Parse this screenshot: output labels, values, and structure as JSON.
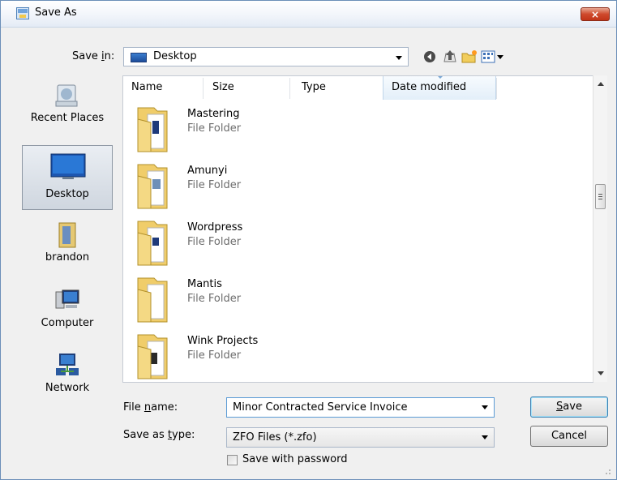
{
  "window": {
    "title": "Save As",
    "close_label": "×"
  },
  "toolbar": {
    "save_in_label_prefix": "Save ",
    "save_in_label_hotkey": "i",
    "save_in_label_suffix": "n:",
    "save_in_value": "Desktop",
    "icons": [
      "back-icon",
      "up-folder-icon",
      "new-folder-icon",
      "views-menu-icon"
    ]
  },
  "places": [
    {
      "label": "Recent Places",
      "icon": "recent-places-icon",
      "selected": false
    },
    {
      "label": "Desktop",
      "icon": "desktop-icon",
      "selected": true
    },
    {
      "label": "brandon",
      "icon": "user-folder-icon",
      "selected": false
    },
    {
      "label": "Computer",
      "icon": "computer-icon",
      "selected": false
    },
    {
      "label": "Network",
      "icon": "network-icon",
      "selected": false
    }
  ],
  "columns": [
    "Name",
    "Size",
    "Type",
    "Date modified"
  ],
  "files": [
    {
      "name": "Mastering",
      "type": "File Folder"
    },
    {
      "name": "Amunyi",
      "type": "File Folder"
    },
    {
      "name": "Wordpress",
      "type": "File Folder"
    },
    {
      "name": "Mantis",
      "type": "File Folder"
    },
    {
      "name": "Wink Projects",
      "type": "File Folder"
    }
  ],
  "form": {
    "file_name_label_prefix": "File ",
    "file_name_label_hotkey": "n",
    "file_name_label_suffix": "ame:",
    "file_name_value": "Minor Contracted Service Invoice",
    "save_type_label_prefix": "Save as ",
    "save_type_label_hotkey": "t",
    "save_type_label_suffix": "ype:",
    "save_type_value": "ZFO Files (*.zfo)",
    "password_label": "Save with password",
    "password_checked": false
  },
  "buttons": {
    "save_hotkey": "S",
    "save_rest": "ave",
    "cancel": "Cancel"
  },
  "colors": {
    "accent": "#3c7fb1",
    "close": "#c13418",
    "selection": "#cfd6df"
  }
}
